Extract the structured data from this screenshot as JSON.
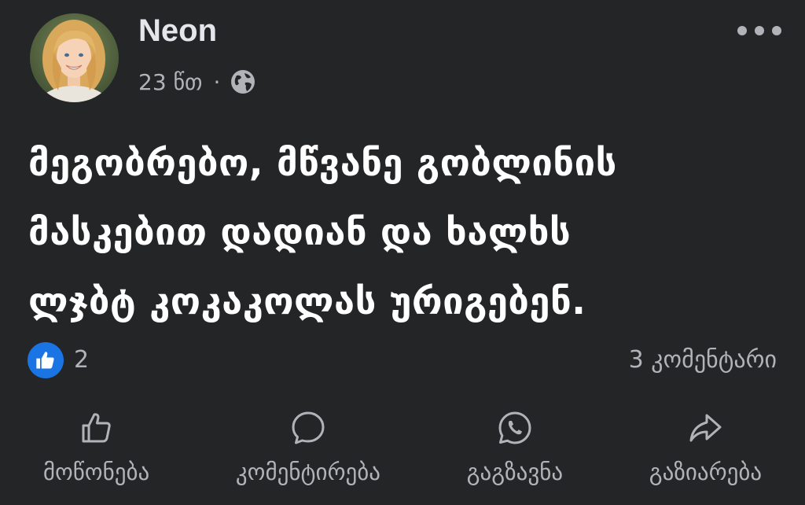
{
  "post": {
    "author": "Neon",
    "timestamp": "23 წთ",
    "separator": "·",
    "privacy_icon": "globe-icon",
    "text_lines": [
      "მეგობრებო, მწვანე გობლინის",
      "მასკებით დადიან და ხალხს",
      "ლჯბტ კოკაკოლას ურიგებენ."
    ]
  },
  "reactions": {
    "icon": "like-icon",
    "count": "2",
    "comments": "3 კომენტარი"
  },
  "actions": {
    "like": "მოწონება",
    "comment": "კომენტირება",
    "send": "გაგზავნა",
    "share": "გაზიარება"
  },
  "colors": {
    "background": "#242526",
    "text_primary": "#ffffff",
    "text_secondary": "#b0b3b8",
    "like_blue": "#1b74e4"
  }
}
